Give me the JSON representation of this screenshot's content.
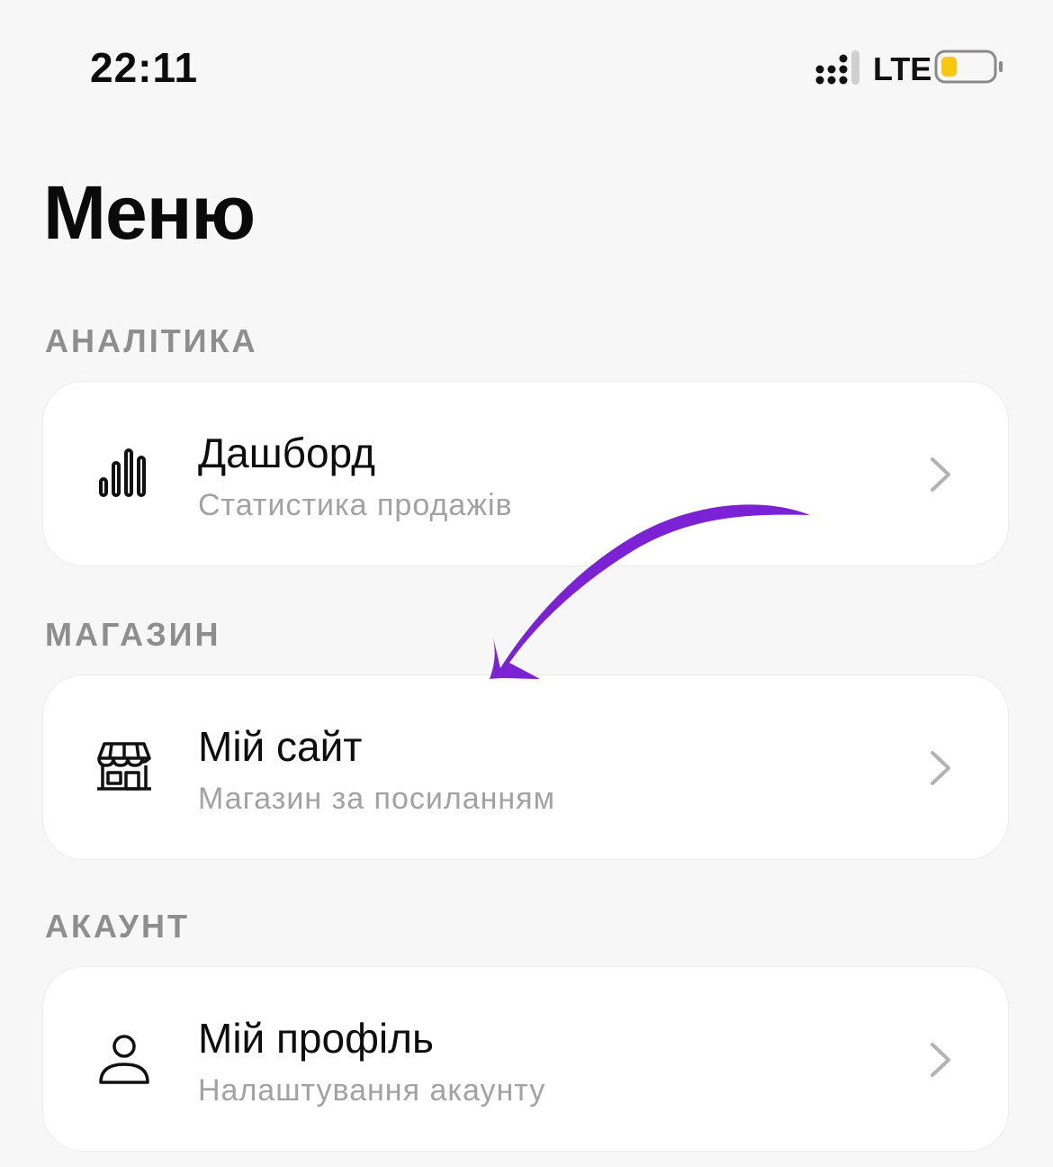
{
  "status_bar": {
    "time": "22:11",
    "network": "LTE",
    "icons": [
      "signal-icon",
      "battery-icon"
    ],
    "battery_fill_color": "#f9c80e"
  },
  "page": {
    "title": "Меню"
  },
  "sections": [
    {
      "header": "АНАЛІТИКА",
      "item": {
        "icon": "bar-chart-icon",
        "title": "Дашборд",
        "subtitle": "Статистика продажів"
      }
    },
    {
      "header": "МАГАЗИН",
      "item": {
        "icon": "storefront-icon",
        "title": "Мій сайт",
        "subtitle": "Магазин за посиланням"
      }
    },
    {
      "header": "АКАУНТ",
      "item": {
        "icon": "user-icon",
        "title": "Мій профіль",
        "subtitle": "Налаштування акаунту"
      }
    }
  ],
  "annotation": {
    "icon": "curved-arrow-icon",
    "color": "#7b22d4"
  }
}
